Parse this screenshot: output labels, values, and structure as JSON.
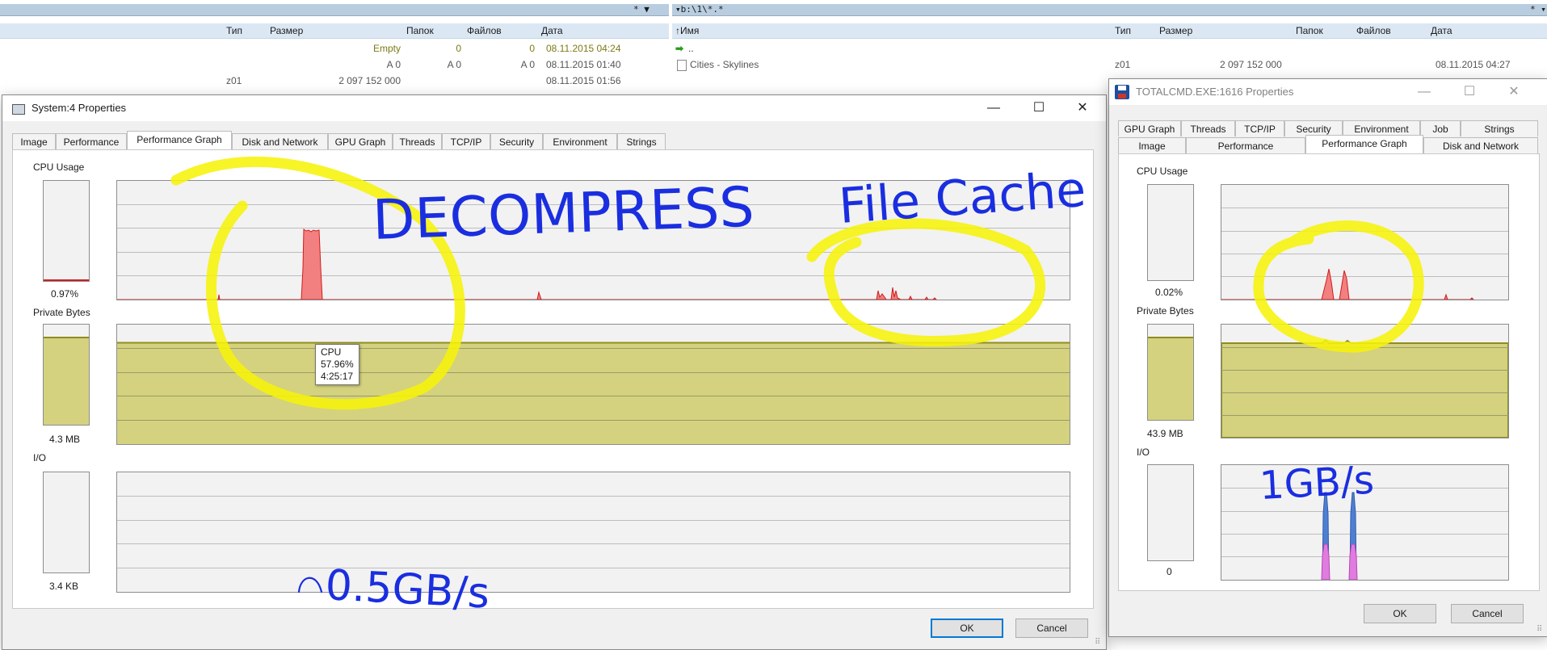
{
  "file_manager": {
    "left": {
      "controls": "* ▼",
      "columns": [
        "Тип",
        "Размер",
        "Папок",
        "Файлов",
        "Дата"
      ],
      "rows": [
        {
          "type": "",
          "size": "Empty",
          "folders": "0",
          "files": "0",
          "date": "08.11.2015 04:24"
        },
        {
          "type": "",
          "size": "A 0",
          "folders": "A 0",
          "files": "A 0",
          "date": "08.11.2015 01:40"
        },
        {
          "type": "z01",
          "size": "2 097 152 000",
          "folders": "",
          "files": "",
          "date": "08.11.2015 01:56"
        }
      ]
    },
    "right": {
      "path": "▾b:\\1\\*.*",
      "controls": "* ▾",
      "columns": [
        "↑Имя",
        "Тип",
        "Размер",
        "Папок",
        "Файлов",
        "Дата"
      ],
      "rows": [
        {
          "name": "..",
          "type": "",
          "size": "",
          "date": ""
        },
        {
          "name": "Cities - Skylines",
          "type": "z01",
          "size": "2 097 152 000",
          "date": "08.11.2015 04:27"
        }
      ]
    }
  },
  "system_dialog": {
    "title": "System:4 Properties",
    "tabs": [
      "Image",
      "Performance",
      "Performance Graph",
      "Disk and Network",
      "GPU Graph",
      "Threads",
      "TCP/IP",
      "Security",
      "Environment",
      "Strings"
    ],
    "active_tab": "Performance Graph",
    "cpu_label": "CPU Usage",
    "cpu_value": "0.97%",
    "cpu_level": 0.0097,
    "private_label": "Private Bytes",
    "private_value": "4.3 MB",
    "private_level": 0.86,
    "io_label": "I/O",
    "io_value": "3.4  KB",
    "tooltip": {
      "line1": "CPU",
      "line2": "57.96%",
      "line3": "4:25:17"
    },
    "ok": "OK",
    "cancel": "Cancel",
    "colors": {
      "cpu": "#f28080",
      "cpu_stroke": "#d21c1c",
      "private": "#d4d27e",
      "private_stroke": "#8f8d1f"
    }
  },
  "totalcmd_dialog": {
    "title": "TOTALCMD.EXE:1616 Properties",
    "tabs_row1": [
      "GPU Graph",
      "Threads",
      "TCP/IP",
      "Security",
      "Environment",
      "Job",
      "Strings"
    ],
    "tabs_row2": [
      "Image",
      "Performance",
      "Performance Graph",
      "Disk and Network"
    ],
    "active_tab": "Performance Graph",
    "cpu_label": "CPU Usage",
    "cpu_value": "0.02%",
    "private_label": "Private Bytes",
    "private_value": "43.9 MB",
    "private_level": 0.86,
    "io_label": "I/O",
    "io_value": "0",
    "ok": "OK",
    "cancel": "Cancel",
    "colors": {
      "io_read": "#4f7fd0",
      "io_write": "#e07be0"
    }
  },
  "annotations": {
    "decompress": "DECOMPRESS",
    "file_cache": "File Cache",
    "left_io_rate": "0.5GB/s",
    "right_io_rate": "1GB/s",
    "highlight_color": "#f6f20a",
    "ink_color": "#1a2ee0"
  }
}
